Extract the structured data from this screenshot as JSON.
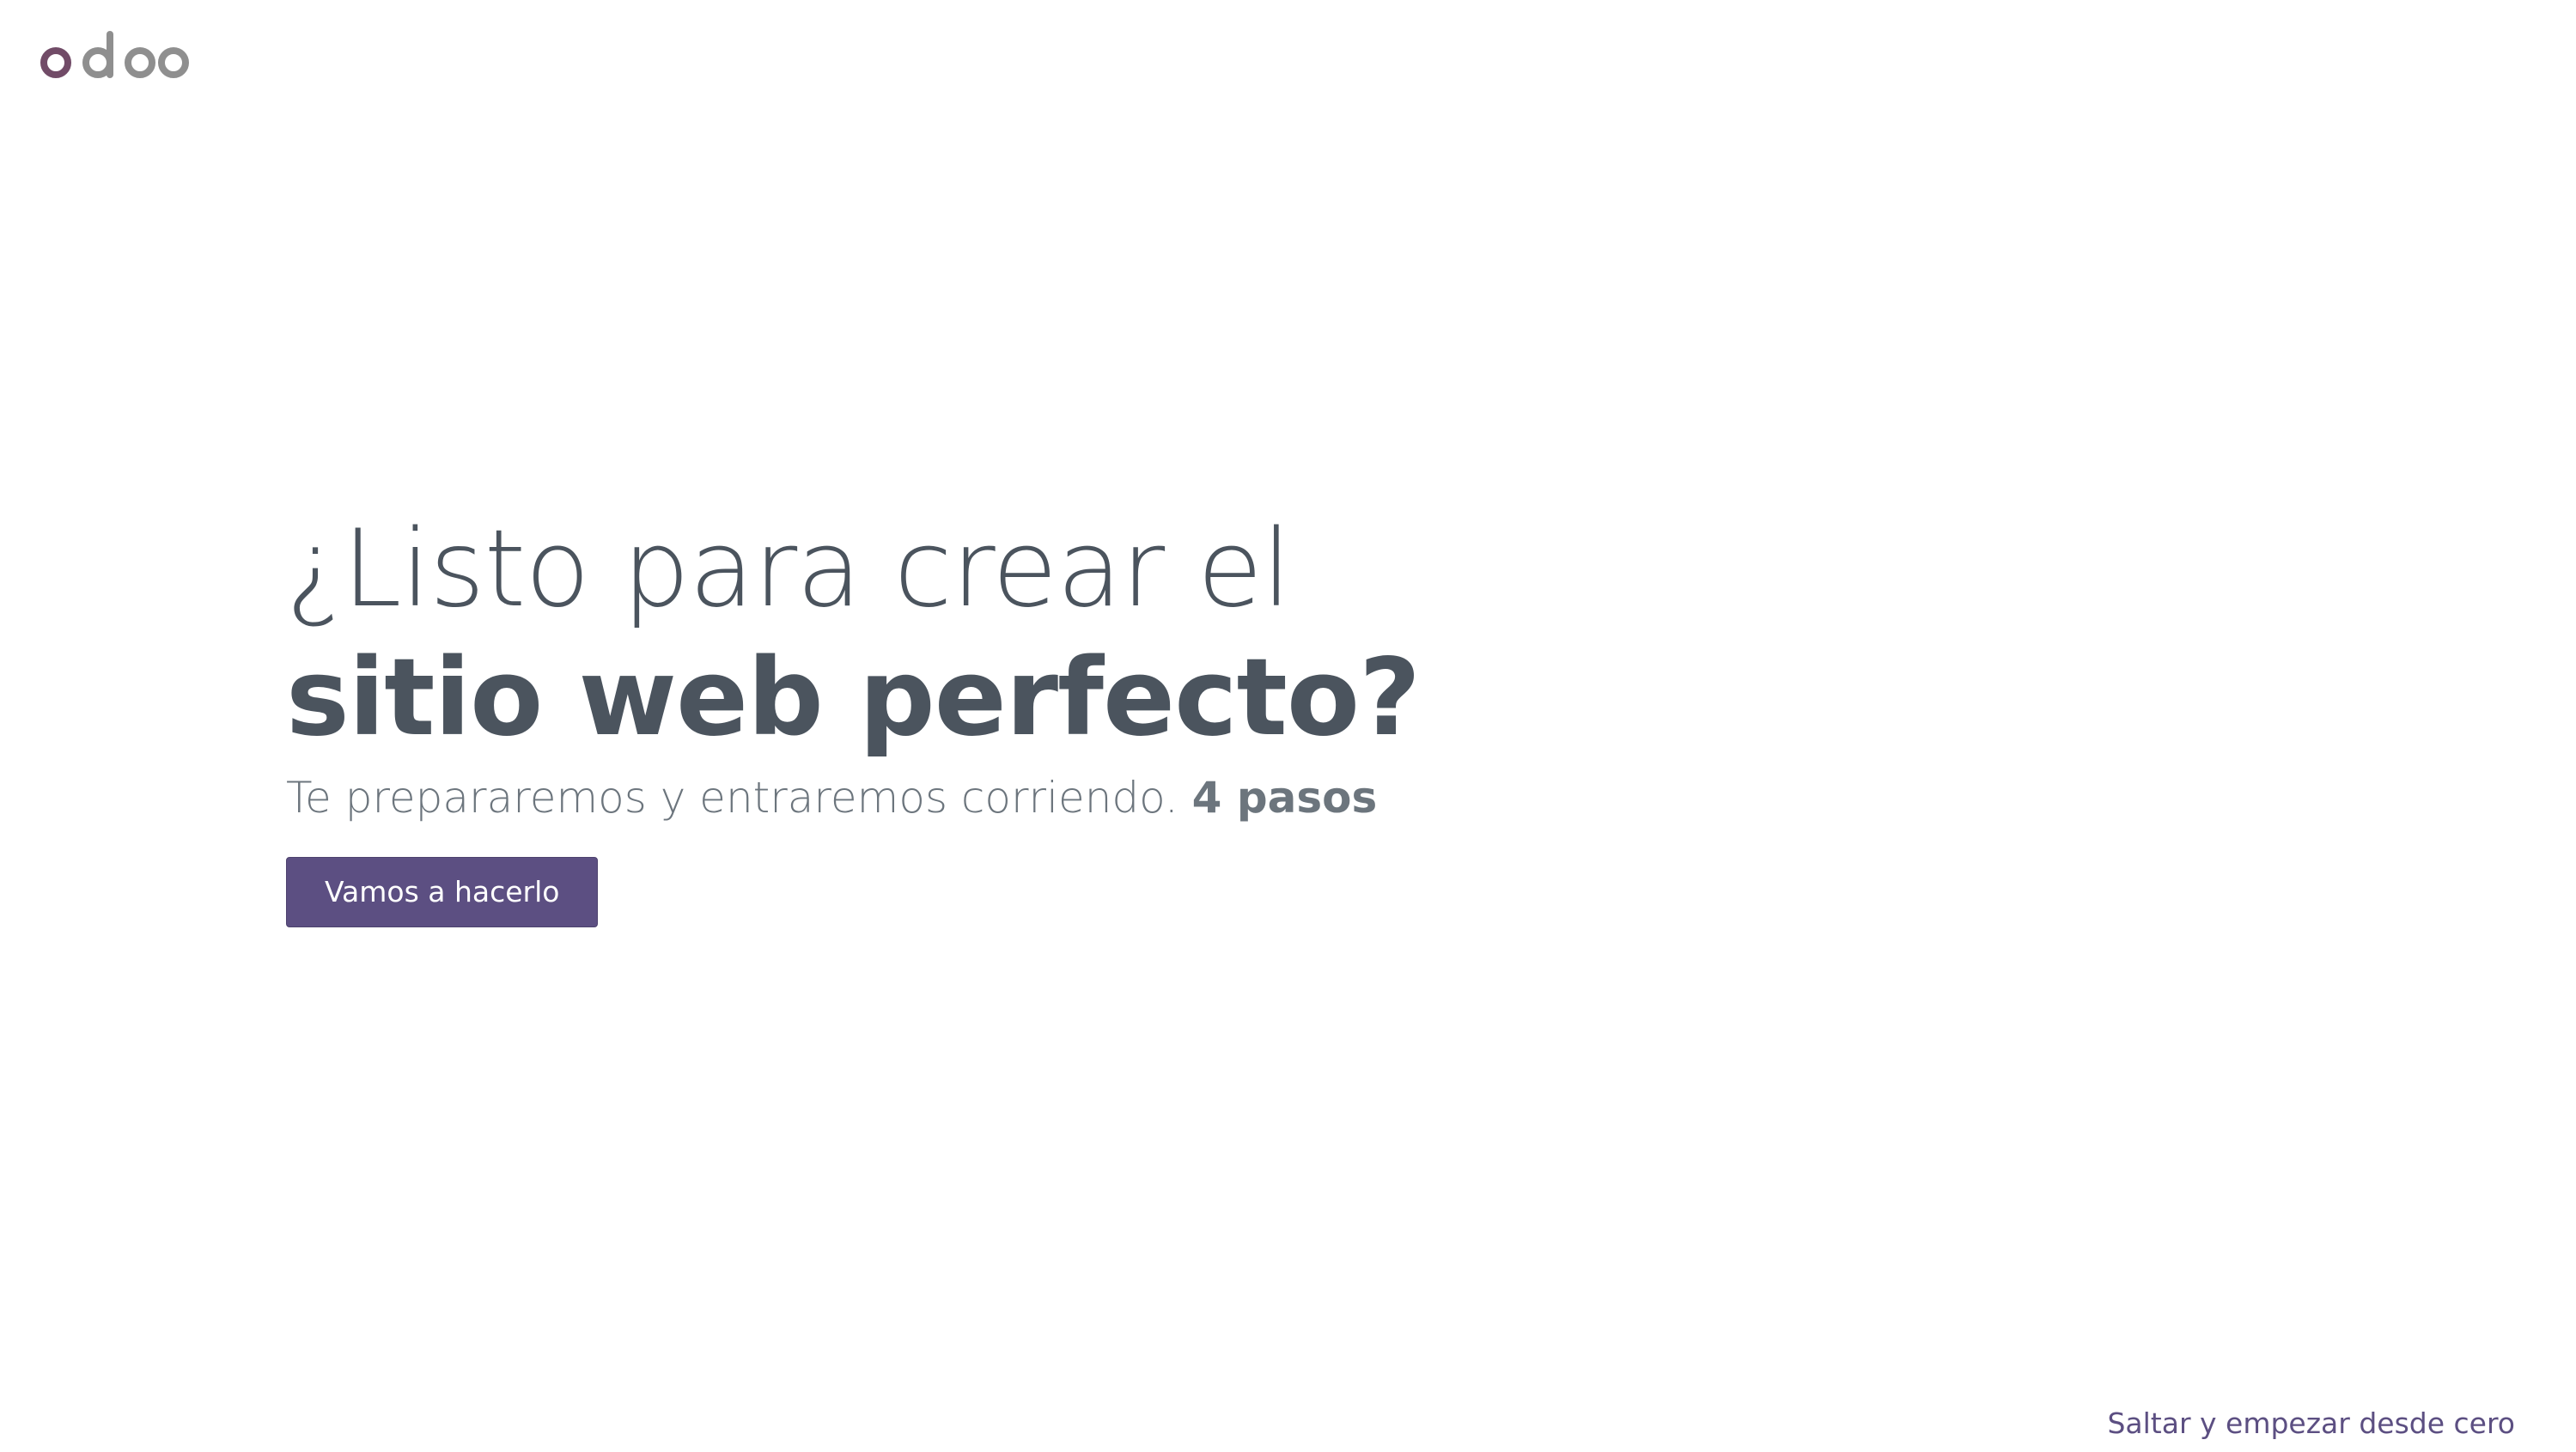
{
  "brand": {
    "logo_text": "odoo",
    "primary_color": "#5c4f82",
    "logo_accent_color": "#714b67",
    "logo_gray_color": "#8f8f8f"
  },
  "hero": {
    "title_line1": "¿Listo para crear el",
    "title_line2": "sitio web perfecto?",
    "subtitle": "Te prepararemos y entraremos corriendo. ",
    "subtitle_steps": "4 pasos",
    "cta_label": "Vamos a hacerlo"
  },
  "footer": {
    "skip_label": "Saltar y empezar desde cero"
  }
}
